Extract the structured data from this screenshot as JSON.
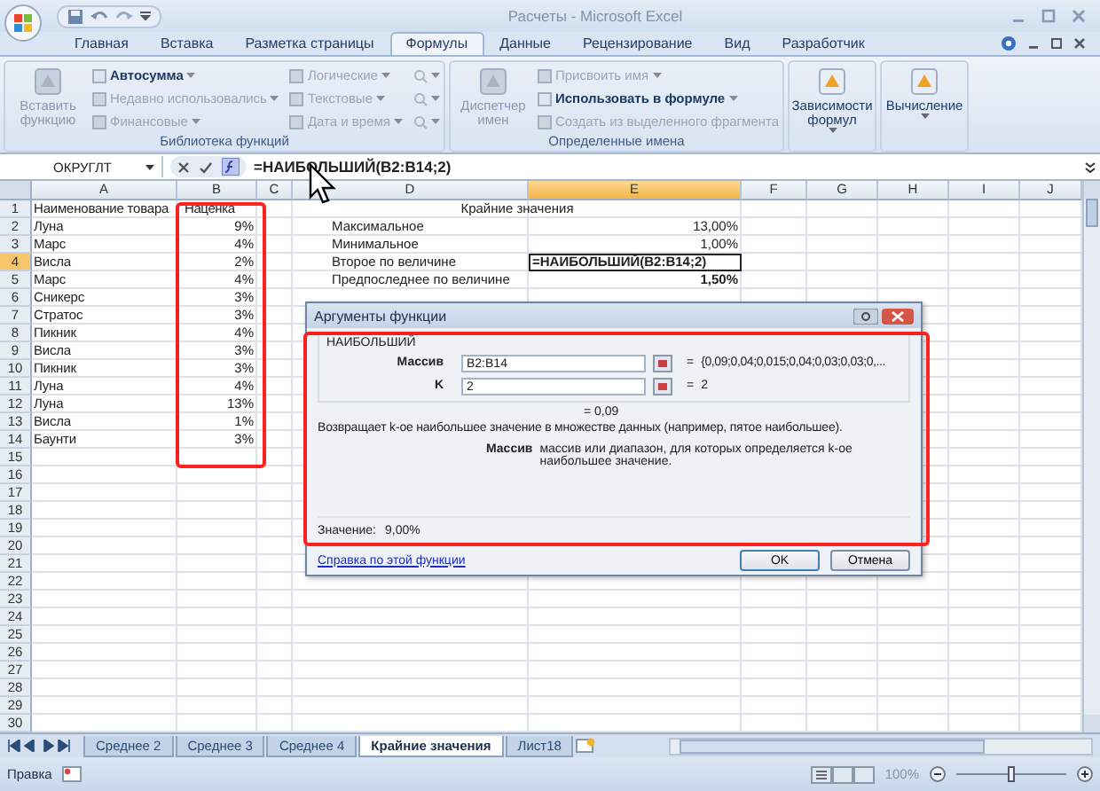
{
  "window": {
    "title": "Расчеты - Microsoft Excel"
  },
  "ribbon_tabs": [
    {
      "label": "Главная",
      "selected": false
    },
    {
      "label": "Вставка",
      "selected": false
    },
    {
      "label": "Разметка страницы",
      "selected": false
    },
    {
      "label": "Формулы",
      "selected": true
    },
    {
      "label": "Данные",
      "selected": false
    },
    {
      "label": "Рецензирование",
      "selected": false
    },
    {
      "label": "Вид",
      "selected": false
    },
    {
      "label": "Разработчик",
      "selected": false
    }
  ],
  "ribbon_groups": [
    {
      "label": "Библиотека функций",
      "items": [
        {
          "kind": "big",
          "label": "Вставить функцию",
          "disabled": true,
          "dropdown": false
        },
        {
          "kind": "small",
          "label": "Автосумма",
          "disabled": false,
          "dropdown": true
        },
        {
          "kind": "small",
          "label": "Недавно использовались",
          "disabled": true,
          "dropdown": true
        },
        {
          "kind": "small",
          "label": "Финансовые",
          "disabled": true,
          "dropdown": true
        },
        {
          "kind": "small",
          "label": "Логические",
          "disabled": true,
          "dropdown": true
        },
        {
          "kind": "small",
          "label": "Текстовые",
          "disabled": true,
          "dropdown": true
        },
        {
          "kind": "small",
          "label": "Дата и время",
          "disabled": true,
          "dropdown": true
        },
        {
          "kind": "icon",
          "disabled": true,
          "dropdown": true
        },
        {
          "kind": "icon",
          "disabled": true,
          "dropdown": true
        },
        {
          "kind": "icon",
          "disabled": true,
          "dropdown": true
        }
      ]
    },
    {
      "label": "Определенные имена",
      "items": [
        {
          "kind": "big",
          "label": "Диспетчер имен",
          "disabled": true,
          "dropdown": false
        },
        {
          "kind": "small",
          "label": "Присвоить имя",
          "disabled": true,
          "dropdown": true
        },
        {
          "kind": "small",
          "label": "Использовать в формуле",
          "disabled": false,
          "dropdown": true
        },
        {
          "kind": "small",
          "label": "Создать из выделенного фрагмента",
          "disabled": true,
          "dropdown": false
        }
      ]
    },
    {
      "items": [
        {
          "kind": "big",
          "label": "Зависимости формул",
          "disabled": false,
          "dropdown": true
        }
      ]
    },
    {
      "items": [
        {
          "kind": "big",
          "label": "Вычисление",
          "disabled": false,
          "dropdown": true
        }
      ]
    }
  ],
  "name_box": "ОКРУГЛТ",
  "formula": "=НАИБОЛЬШИЙ(B2:B14;2)",
  "columns": [
    {
      "label": "A",
      "selected": false
    },
    {
      "label": "B",
      "selected": false
    },
    {
      "label": "C",
      "selected": false
    },
    {
      "label": "D",
      "selected": false
    },
    {
      "label": "E",
      "selected": true
    },
    {
      "label": "F",
      "selected": false
    },
    {
      "label": "G",
      "selected": false
    },
    {
      "label": "H",
      "selected": false
    },
    {
      "label": "I",
      "selected": false
    },
    {
      "label": "J",
      "selected": false
    }
  ],
  "rows": [
    {
      "number": "1",
      "selected": false,
      "cells": {
        "A": {
          "kind": "text",
          "text": "Наименование товара"
        },
        "B": {
          "kind": "header",
          "text": "Наценка"
        },
        "D": {
          "kind": "title",
          "text": "Крайние значения"
        }
      }
    },
    {
      "number": "2",
      "selected": false,
      "cells": {
        "A": {
          "kind": "text",
          "text": "Луна"
        },
        "B": {
          "kind": "number",
          "text": "9%"
        },
        "D": {
          "kind": "label",
          "text": "Максимальное"
        },
        "E": {
          "kind": "number",
          "text": "13,00%"
        }
      }
    },
    {
      "number": "3",
      "selected": false,
      "cells": {
        "A": {
          "kind": "text",
          "text": "Марс"
        },
        "B": {
          "kind": "number",
          "text": "4%"
        },
        "D": {
          "kind": "label",
          "text": "Минимальное"
        },
        "E": {
          "kind": "number",
          "text": "1,00%"
        }
      }
    },
    {
      "number": "4",
      "selected": true,
      "cells": {
        "A": {
          "kind": "text",
          "text": "Висла"
        },
        "B": {
          "kind": "number",
          "text": "2%"
        },
        "D": {
          "kind": "label",
          "text": "Второе по величине"
        },
        "E": {
          "kind": "editing",
          "text": "=НАИБОЛЬШИЙ(B2:B14;2)"
        }
      }
    },
    {
      "number": "5",
      "selected": false,
      "cells": {
        "A": {
          "kind": "text",
          "text": "Марс"
        },
        "B": {
          "kind": "number",
          "text": "4%"
        },
        "D": {
          "kind": "label",
          "text": "Предпоследнее по величине"
        },
        "E": {
          "kind": "total",
          "text": "1,50%"
        }
      }
    },
    {
      "number": "6",
      "selected": false,
      "cells": {
        "A": {
          "kind": "text",
          "text": "Сникерс"
        },
        "B": {
          "kind": "number",
          "text": "3%"
        }
      }
    },
    {
      "number": "7",
      "selected": false,
      "cells": {
        "A": {
          "kind": "text",
          "text": "Стратос"
        },
        "B": {
          "kind": "number",
          "text": "3%"
        }
      }
    },
    {
      "number": "8",
      "selected": false,
      "cells": {
        "A": {
          "kind": "text",
          "text": "Пикник"
        },
        "B": {
          "kind": "number",
          "text": "4%"
        }
      }
    },
    {
      "number": "9",
      "selected": false,
      "cells": {
        "A": {
          "kind": "text",
          "text": "Висла"
        },
        "B": {
          "kind": "number",
          "text": "3%"
        }
      }
    },
    {
      "number": "10",
      "selected": false,
      "cells": {
        "A": {
          "kind": "text",
          "text": "Пикник"
        },
        "B": {
          "kind": "number",
          "text": "3%"
        }
      }
    },
    {
      "number": "11",
      "selected": false,
      "cells": {
        "A": {
          "kind": "text",
          "text": "Луна"
        },
        "B": {
          "kind": "number",
          "text": "4%"
        }
      }
    },
    {
      "number": "12",
      "selected": false,
      "cells": {
        "A": {
          "kind": "text",
          "text": "Луна"
        },
        "B": {
          "kind": "number",
          "text": "13%"
        }
      }
    },
    {
      "number": "13",
      "selected": false,
      "cells": {
        "A": {
          "kind": "text",
          "text": "Висла"
        },
        "B": {
          "kind": "number",
          "text": "1%"
        }
      }
    },
    {
      "number": "14",
      "selected": false,
      "cells": {
        "A": {
          "kind": "text",
          "text": "Баунти"
        },
        "B": {
          "kind": "number",
          "text": "3%"
        }
      }
    },
    {
      "number": "15",
      "selected": false
    },
    {
      "number": "16",
      "selected": false
    },
    {
      "number": "17",
      "selected": false
    },
    {
      "number": "18",
      "selected": false
    },
    {
      "number": "19",
      "selected": false
    },
    {
      "number": "20",
      "selected": false
    },
    {
      "number": "21",
      "selected": false
    },
    {
      "number": "22",
      "selected": false
    },
    {
      "number": "23",
      "selected": false
    },
    {
      "number": "24",
      "selected": false
    },
    {
      "number": "25",
      "selected": false
    },
    {
      "number": "26",
      "selected": false
    },
    {
      "number": "27",
      "selected": false
    },
    {
      "number": "28",
      "selected": false
    },
    {
      "number": "29",
      "selected": false
    },
    {
      "number": "30",
      "selected": false
    }
  ],
  "dialog": {
    "title": "Аргументы функции",
    "function": "НАИБОЛЬШИЙ",
    "arguments": [
      {
        "name": "Массив",
        "value": "B2:B14",
        "equals": "=",
        "result": "{0,09;0,04;0,015;0,04;0,03;0,03;0,..."
      },
      {
        "name": "K",
        "value": "2",
        "equals": "=",
        "result": "2"
      }
    ],
    "total": "= 0,09",
    "description": "Возвращает k-ое наибольшее значение в множестве данных (например, пятое наибольшее).",
    "help_name": "Массив",
    "help_text": "массив или диапазон, для которых определяется k-ое наибольшее значение.",
    "value_label": "Значение:",
    "value": "9,00%",
    "help_link": "Справка по этой функции",
    "buttons": [
      "OK",
      "Отмена"
    ]
  },
  "sheet_tabs": [
    {
      "label": "Среднее 2",
      "selected": false
    },
    {
      "label": "Среднее 3",
      "selected": false
    },
    {
      "label": "Среднее 4",
      "selected": false
    },
    {
      "label": "Крайние значения",
      "selected": true
    },
    {
      "label": "Лист18",
      "selected": false
    }
  ],
  "status_bar": {
    "mode": "Правка",
    "zoom": "100%",
    "level": 0.5
  }
}
